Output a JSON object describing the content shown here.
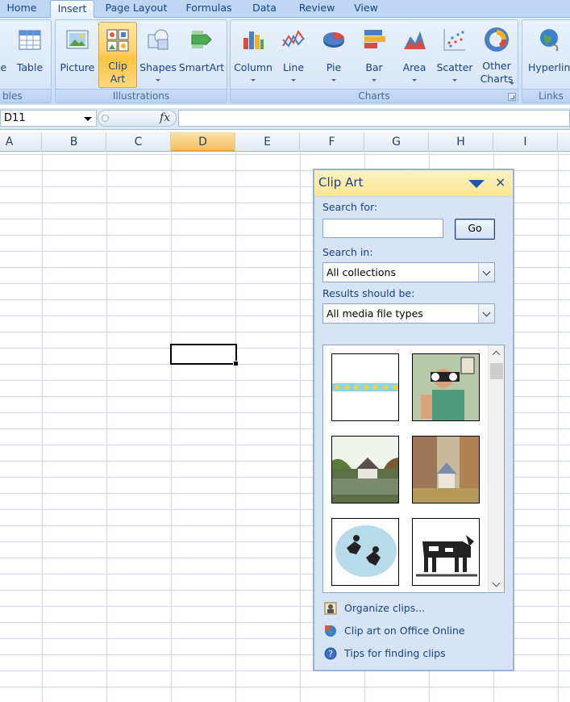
{
  "tabs": [
    {
      "label": "Home",
      "active": false
    },
    {
      "label": "Insert",
      "active": true
    },
    {
      "label": "Page Layout",
      "active": false
    },
    {
      "label": "Formulas",
      "active": false
    },
    {
      "label": "Data",
      "active": false
    },
    {
      "label": "Review",
      "active": false
    },
    {
      "label": "View",
      "active": false
    }
  ],
  "ribbon": {
    "groups": {
      "tables": "bles",
      "illustrations": "Illustrations",
      "charts": "Charts",
      "links": "Links"
    },
    "buttons": {
      "pivot_partial": "le",
      "table": "Table",
      "picture": "Picture",
      "clip_art": "Clip Art",
      "shapes": "Shapes",
      "smartart": "SmartArt",
      "column": "Column",
      "line": "Line",
      "pie": "Pie",
      "bar": "Bar",
      "area": "Area",
      "scatter": "Scatter",
      "other_charts": "Other Charts",
      "hyperlink": "Hyperlink"
    },
    "selected_button": "clip_art"
  },
  "formula_bar": {
    "name_box": "D11",
    "fx_symbol": "fx",
    "formula": ""
  },
  "sheet": {
    "columns": [
      "A",
      "B",
      "C",
      "D",
      "E",
      "F",
      "G",
      "H",
      "I"
    ],
    "active_column": "D",
    "active_cell": "D11"
  },
  "clip_art_pane": {
    "title": "Clip Art",
    "close_glyph": "×",
    "search_label": "Search for:",
    "search_value": "",
    "go_label": "Go",
    "search_in_label": "Search in:",
    "search_in_value": "All collections",
    "results_label": "Results should be:",
    "results_value": "All media file types",
    "results": [
      "dotted-border-clip",
      "man-with-binoculars-clip",
      "house-by-lake-clip",
      "autumn-forest-cottage-clip",
      "running-figures-clip",
      "cow-clip"
    ],
    "links": [
      {
        "label": "Organize clips...",
        "icon": "organize-clips-icon"
      },
      {
        "label": "Clip art on Office Online",
        "icon": "office-online-icon"
      },
      {
        "label": "Tips for finding clips",
        "icon": "help-icon"
      }
    ]
  },
  "colors": {
    "ribbon_text": "#15428b",
    "selected_button": "#ffd26b",
    "pane_background": "#d6e4f5",
    "pane_title": "#fde594"
  }
}
